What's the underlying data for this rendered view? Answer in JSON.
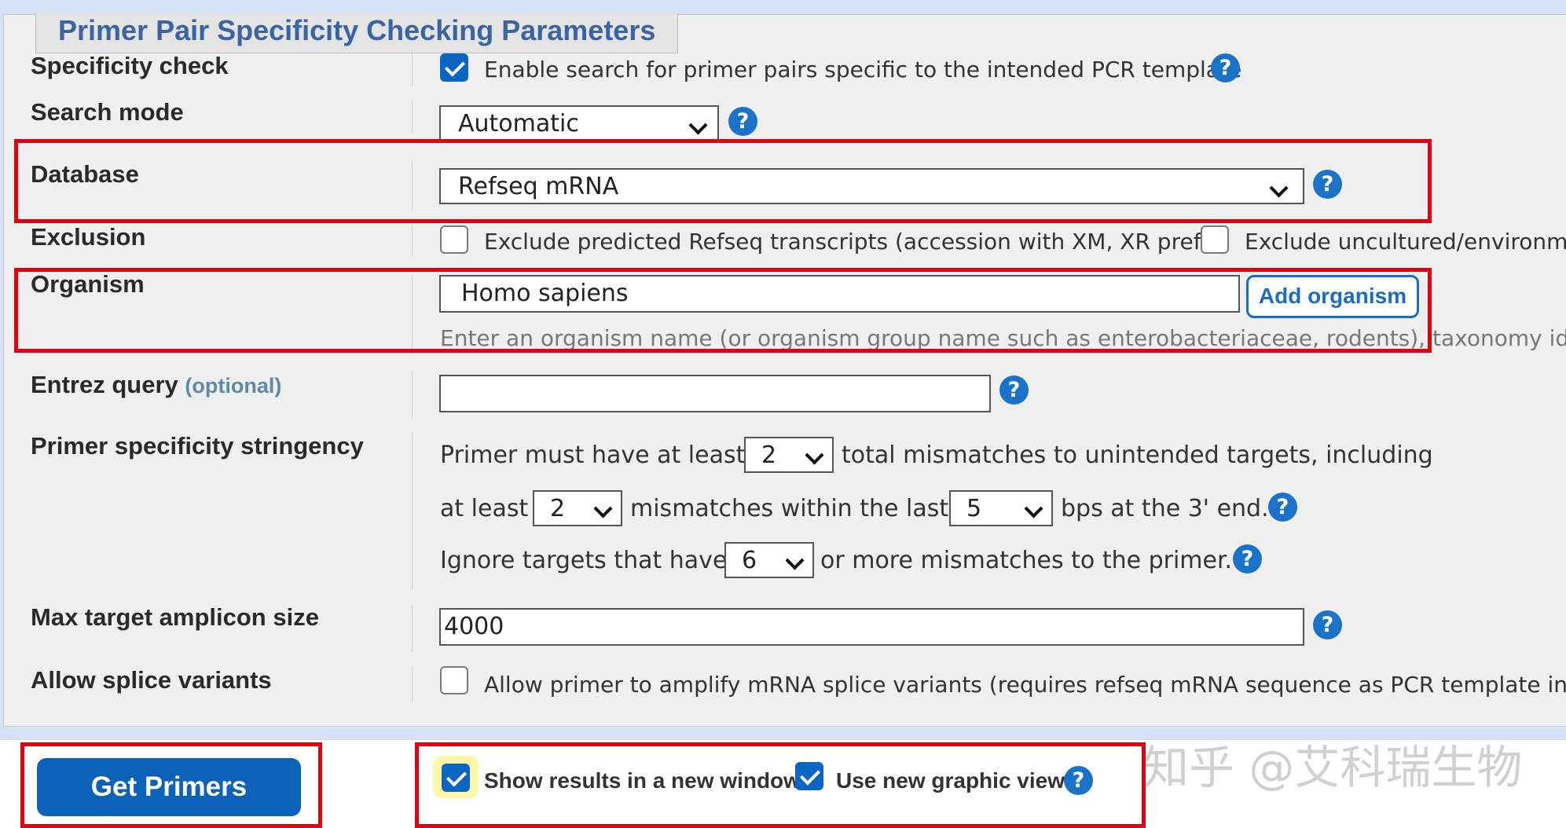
{
  "legend": "Primer Pair Specificity Checking Parameters",
  "rows": {
    "specificity": {
      "label": "Specificity check",
      "text": "Enable search for primer pairs specific to the intended PCR template",
      "checked": true
    },
    "search_mode": {
      "label": "Search mode",
      "value": "Automatic"
    },
    "database": {
      "label": "Database",
      "value": "Refseq mRNA"
    },
    "exclusion": {
      "label": "Exclusion",
      "opt1": "Exclude predicted Refseq transcripts (accession with XM, XR prefix)",
      "opt2": "Exclude uncultured/environme"
    },
    "organism": {
      "label": "Organism",
      "value": "Homo sapiens",
      "button": "Add organism",
      "hint": "Enter an organism name (or organism group name such as enterobacteriaceae, rodents), taxonomy id or sel"
    },
    "entrez": {
      "label": "Entrez query",
      "optional": "(optional)",
      "value": ""
    },
    "stringency": {
      "label": "Primer specificity stringency",
      "line1_a": "Primer must have at least",
      "line1_sel": "2",
      "line1_b": "total mismatches to unintended targets, including",
      "line2_a": "at least",
      "line2_sel1": "2",
      "line2_b": "mismatches within the last",
      "line2_sel2": "5",
      "line2_c": "bps at the 3' end.",
      "line3_a": "Ignore targets that have",
      "line3_sel": "6",
      "line3_b": "or more mismatches to the primer."
    },
    "max_amplicon": {
      "label": "Max target amplicon size",
      "value": "4000"
    },
    "splice": {
      "label": "Allow splice variants",
      "text": "Allow primer to amplify mRNA splice variants (requires refseq mRNA sequence as PCR template input)",
      "checked": false
    }
  },
  "bottom": {
    "get_primers": "Get Primers",
    "new_window": "Show results in a new window",
    "graphic_view": "Use new graphic view"
  },
  "watermark": "知乎 @艾科瑞生物",
  "colors": {
    "accent": "#0c62b9",
    "highlight": "#e00010",
    "legend": "#3a64a4"
  },
  "help_glyph": "?"
}
